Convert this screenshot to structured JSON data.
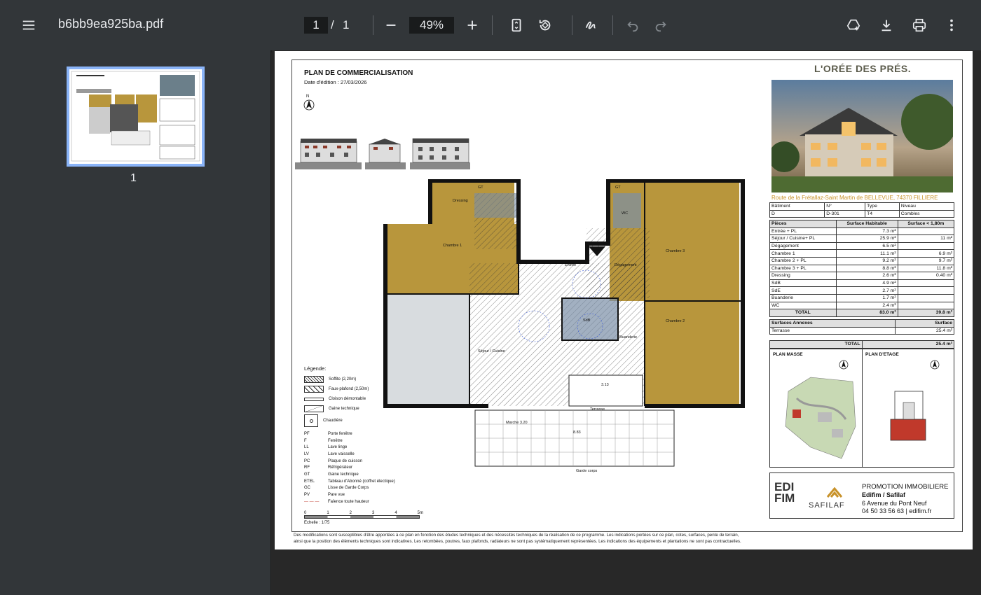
{
  "toolbar": {
    "title": "b6bb9ea925ba.pdf",
    "page_current": "1",
    "page_separator": "/",
    "page_total": "1",
    "zoom": "49%"
  },
  "sidebar": {
    "thumbnail_label": "1"
  },
  "doc": {
    "title": "PLAN DE COMMERCIALISATION",
    "date_label": "Date d'édition :",
    "date": "27/03/2026",
    "north": "N",
    "brand": "L'ORÉE DES PRÉS.",
    "address": "Route de la Frétallaz-Saint Martin de BELLEVUE, 74370 FILLIERE",
    "lot_headers": [
      "Bâtiment",
      "N°",
      "Type",
      "Niveau"
    ],
    "lot_values": [
      "D",
      "D-301",
      "T4",
      "Combles"
    ],
    "rooms_headers": [
      "Pièces",
      "Surface Habitable",
      "Surface < 1,80m"
    ],
    "rooms": [
      {
        "name": "Entrée + PL",
        "hab": "7.3 m²",
        "low": ""
      },
      {
        "name": "Séjour / Cuisine+ PL",
        "hab": "25.9 m²",
        "low": "11 m²"
      },
      {
        "name": "Dégagement",
        "hab": "6.5 m²",
        "low": ""
      },
      {
        "name": "Chambre 1",
        "hab": "11.1 m²",
        "low": "6.9 m²"
      },
      {
        "name": "Chambre 2 + PL",
        "hab": "9.2 m²",
        "low": "9.7 m²"
      },
      {
        "name": "Chambre 3 + PL",
        "hab": "8.8 m²",
        "low": "11.8 m²"
      },
      {
        "name": "Dressing",
        "hab": "2.6 m²",
        "low": "0.40 m²"
      },
      {
        "name": "SdB",
        "hab": "4.9 m²",
        "low": ""
      },
      {
        "name": "SdE",
        "hab": "2.7 m²",
        "low": ""
      },
      {
        "name": "Buanderie",
        "hab": "1.7 m²",
        "low": ""
      },
      {
        "name": "WC",
        "hab": "2.4 m²",
        "low": ""
      }
    ],
    "rooms_total": {
      "label": "TOTAL",
      "hab": "83.0 m²",
      "low": "39.8 m²"
    },
    "annex_headers": [
      "Surfaces Annexes",
      "Surface"
    ],
    "annex": [
      {
        "name": "Terrasse",
        "val": "25.4 m²"
      }
    ],
    "grand_total": {
      "label": "TOTAL",
      "val": "25.4 m²"
    },
    "plan_masse": "PLAN MASSE",
    "plan_etage": "PLAN D'ETAGE",
    "promo_line1": "PROMOTION IMMOBILIERE",
    "promo_line2": "Edifim / Safilaf",
    "promo_line3": "6 Avenue du Pont Neuf",
    "promo_line4": "04 50 33 56 63 | edifim.fr",
    "edifim_logo": "EDI FIM",
    "safilaf_logo": "SAFILAF",
    "legend_title": "Légende:",
    "legend_swatches": [
      "Soffite (2,20m)",
      "Faux-plafond (2,50m)",
      "Cloison démontable",
      "Gaine technique",
      "Chaudière"
    ],
    "legend_abbr": [
      [
        "PF",
        "Porte fenêtre"
      ],
      [
        "F",
        "Fenêtre"
      ],
      [
        "LL",
        "Lave linge"
      ],
      [
        "LV",
        "Lave vaisselle"
      ],
      [
        "PC",
        "Plaque de cuisson"
      ],
      [
        "RF",
        "Réfrigérateur"
      ],
      [
        "GT",
        "Gaine technique"
      ],
      [
        "ETEL",
        "Tableau d'Abonné (coffret électique)"
      ],
      [
        "GC",
        "Lisse de Garde Corps"
      ],
      [
        "PV",
        "Pare vue"
      ]
    ],
    "legend_faience": "Faïence toute hauteur",
    "scale_ticks": [
      "0",
      "1",
      "2",
      "3",
      "4",
      "5m"
    ],
    "scale_label": "Echelle : 1/75",
    "rooms_plan": {
      "dressing": "Dressing",
      "chambre1": "Chambre 1",
      "chambre2": "Chambre 2",
      "chambre3": "Chambre 3",
      "sejour": "Séjour / Cuisine",
      "entree": "Entrée",
      "degagement": "Dégagement",
      "terrasse": "Terrasse",
      "buanderie": "Buanderie",
      "sdb": "SdB",
      "wc": "WC",
      "gt1": "GT",
      "gt2": "GT",
      "dim1": "3.13",
      "dim2": "8.83",
      "dim3": "Marche 3.20",
      "garde": "Garde corps"
    },
    "footer_line1": "Des modifications sont susceptibles d'être apportées à ce plan en fonction des études techniques et des nécessités techniques de la réalisation de ce programme.   Les indications portées sur ce plan, cotes, surfaces, pente de terrain,",
    "footer_line2": "ainsi que la position des éléments techniques sont indicatives.  Les retombées, poutres, faux plafonds, radiateurs ne sont pas systématiquement représentées. Les indications des équipements et plantations ne sont pas contractuelles."
  }
}
